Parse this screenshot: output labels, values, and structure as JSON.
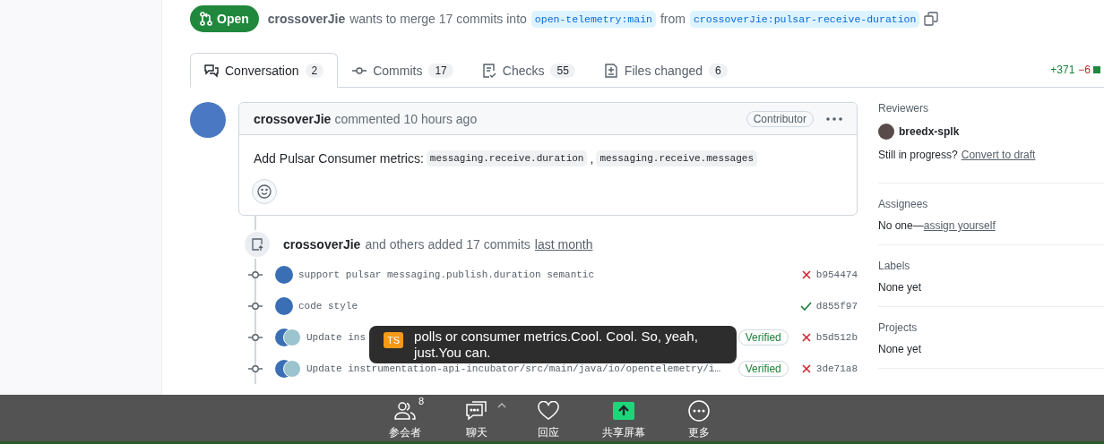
{
  "pr_header": {
    "state": "Open",
    "author": "crossoverJie",
    "summary": "wants to merge 17 commits into",
    "base_branch": "open-telemetry:main",
    "from_word": "from",
    "head_branch": "crossoverJie:pulsar-receive-duration"
  },
  "tabs": [
    {
      "label": "Conversation",
      "count": "2",
      "selected": true,
      "kind": "conversation"
    },
    {
      "label": "Commits",
      "count": "17",
      "selected": false,
      "kind": "commits"
    },
    {
      "label": "Checks",
      "count": "55",
      "selected": false,
      "kind": "checks"
    },
    {
      "label": "Files changed",
      "count": "6",
      "selected": false,
      "kind": "files"
    }
  ],
  "diffstat": {
    "additions": "+371",
    "deletions": "−6"
  },
  "comment": {
    "author": "crossoverJie",
    "action": "commented 10 hours ago",
    "role": "Contributor",
    "body_text": "Add Pulsar Consumer metrics:",
    "code_spans": [
      "messaging.receive.duration",
      "messaging.receive.messages"
    ],
    "separator": ","
  },
  "commit_event": {
    "author": "crossoverJie",
    "text": "and others added 17 commits",
    "time": "last month"
  },
  "commits": [
    {
      "message": "support pulsar messaging.publish.duration semantic",
      "sha": "b954474",
      "passed": false,
      "verified": false,
      "co_authored": false
    },
    {
      "message": "code style",
      "sha": "d855f97",
      "passed": true,
      "verified": false,
      "co_authored": false
    },
    {
      "message": "Update ins",
      "sha": "b5d512b",
      "passed": false,
      "verified": true,
      "verified_label": "Verified",
      "co_authored": true
    },
    {
      "message": "Update instrumentation-api-incubator/src/main/java/io/opentelemetry/i…",
      "sha": "3de71a8",
      "passed": false,
      "verified": true,
      "verified_label": "Verified",
      "co_authored": true
    }
  ],
  "sidebar": {
    "reviewers_title": "Reviewers",
    "reviewer": "breedx-splk",
    "draft_prompt": "Still in progress?",
    "draft_link": "Convert to draft",
    "sections": [
      {
        "title": "Assignees",
        "text": "No one—",
        "link": "assign yourself"
      },
      {
        "title": "Labels",
        "text": "None yet"
      },
      {
        "title": "Projects",
        "text": "None yet"
      }
    ]
  },
  "caption": {
    "speaker": "TS",
    "text": "polls or consumer metrics.Cool. Cool. So, yeah, just.You can."
  },
  "meeting_toolbar": [
    {
      "label": "参会者",
      "kind": "participants",
      "badge": "8"
    },
    {
      "label": "聊天",
      "kind": "chat"
    },
    {
      "label": "回应",
      "kind": "react"
    },
    {
      "label": "共享屏幕",
      "kind": "share"
    },
    {
      "label": "更多",
      "kind": "more"
    }
  ]
}
